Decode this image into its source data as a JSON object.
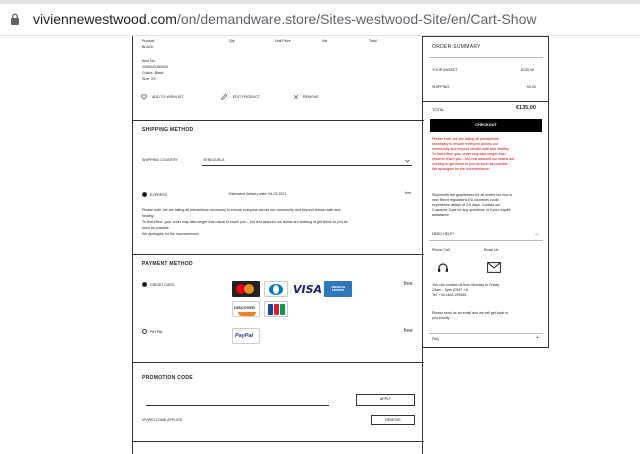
{
  "browser": {
    "url_host": "viviennewestwood.com",
    "url_path": "/on/demandware.store/Sites-westwood-Site/en/Cart-Show"
  },
  "cart": {
    "columns": [
      "Product",
      "Qty",
      "Unit Price",
      "Vat",
      "Total"
    ],
    "product": {
      "color_name": "BLACK",
      "item_no": "Item No.",
      "item_no_value": "2305043182003",
      "colour": "Colour: Black",
      "size": "Size: XS"
    },
    "actions": {
      "wishlist": "ADD TO WISHLIST",
      "edit": "EDIT PRODUCT",
      "remove": "REMOVE"
    }
  },
  "shipping": {
    "title": "SHIPPING METHOD",
    "country_label": "SHIPPING COUNTRY",
    "country_value": "VENEZUELA",
    "method_name": "EXPRESS",
    "delivery_estimate": "Estimated delivery date: 04.03.2021",
    "method_price": "free",
    "notice": [
      "Please note, we are taking all precautions necessary to ensure everyone across our community and beyond remain safe and",
      "healthy.",
      "To that effect, your order may take longer than usual to reach you – but rest assured our teams are working to get these to you as",
      "soon as possible.",
      "We apologise for the inconvenience."
    ]
  },
  "payment": {
    "title": "PAYMENT METHOD",
    "credit_label": "CREDIT CARD",
    "credit_price": "free",
    "paypal_label": "PAYPAL",
    "paypal_price": "free",
    "card_brands": [
      "mastercard",
      "diners",
      "VISA",
      "AMERICAN EXPRESS",
      "DISCOVER",
      "JCB"
    ],
    "paypal_logo": "PayPal"
  },
  "promo": {
    "title": "PROMOTION CODE",
    "apply_label": "APPLY",
    "applied_code": "VIVWELCOME APPLIED",
    "remove_label": "REMOVE"
  },
  "summary": {
    "title": "ORDER SUMMARY",
    "basket_label": "YOUR BASKET",
    "basket_value": "€135,00",
    "shipping_label": "SHIPPING",
    "shipping_value": "€0,00",
    "total_label": "TOTAL",
    "total_value": "€135,00",
    "checkout_label": "CHECKOUT",
    "notice": [
      "Please note, we are taking all precautions",
      "necessary to ensure everyone across our",
      "community and beyond remain safe and healthy.",
      "To that effect, your order may take longer than",
      "usual to reach you – but rest assured our teams are",
      "working to get these to you as soon as possible.",
      "We apologise for the inconvenience."
    ],
    "brexit": [
      "Shipments are guaranteed for all orders but due to",
      "new Brexit regulations EU countries could",
      "experience delays of 2-5 days. Contact our",
      "Customer Care for any questions or if you require",
      "assistance."
    ],
    "need_help": "NEED HELP?",
    "phone_label": "Phone Call",
    "email_label": "Email Us",
    "contact": [
      "You can contact us from Monday to Friday",
      "10am – 6pm (GMT +1)",
      "Tel: +44 1844 259481"
    ],
    "email_note": [
      "Please send us an email and we will get back to",
      "you shortly."
    ],
    "faq": "FAQ",
    "plus": "+",
    "minus": "—"
  },
  "colors": {
    "notice_red": "#d10000",
    "checkout_bg": "#000000",
    "visa_blue": "#1a1f71",
    "amex_blue": "#2e77bb"
  }
}
